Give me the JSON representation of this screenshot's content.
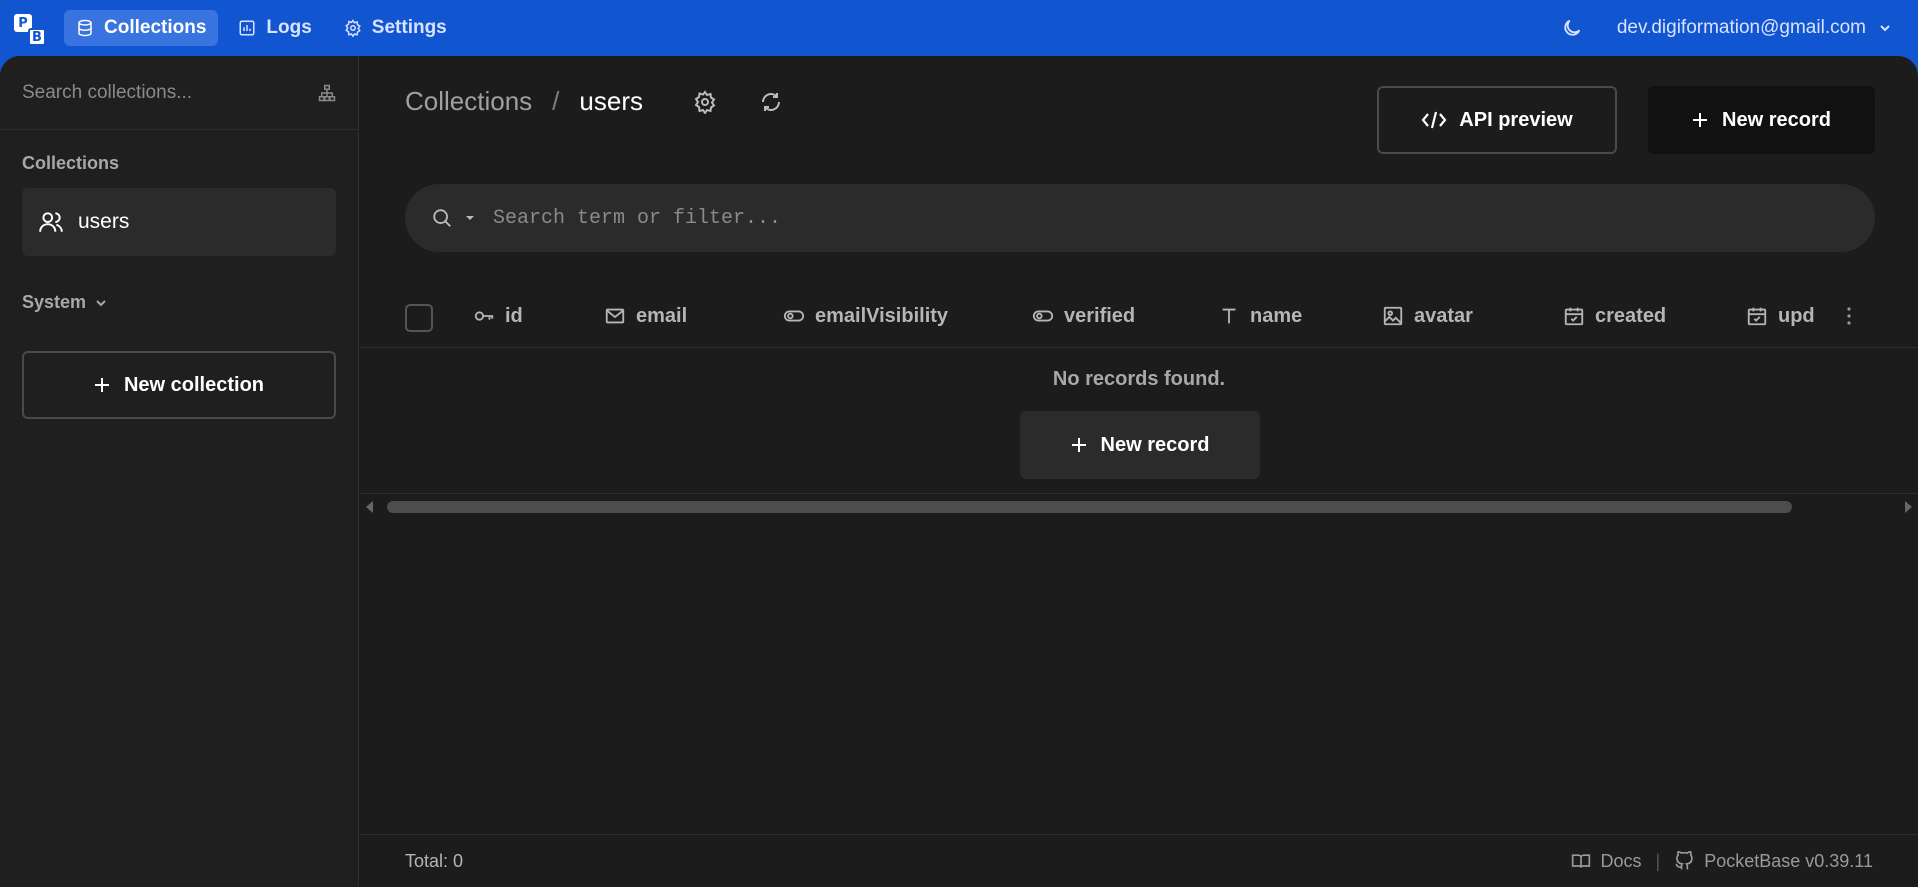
{
  "topbar": {
    "logo_letters": [
      "P",
      "B"
    ],
    "nav": [
      {
        "label": "Collections",
        "icon": "database-icon",
        "active": true
      },
      {
        "label": "Logs",
        "icon": "chart-icon",
        "active": false
      },
      {
        "label": "Settings",
        "icon": "gear-icon",
        "active": false
      }
    ],
    "theme_icon": "moon-icon",
    "user_email": "dev.digiformation@gmail.com"
  },
  "sidebar": {
    "search_placeholder": "Search collections...",
    "section_label": "Collections",
    "collections": [
      {
        "label": "users",
        "icon": "users-icon"
      }
    ],
    "system_label": "System",
    "new_collection_label": "New collection"
  },
  "main": {
    "breadcrumb": {
      "root": "Collections",
      "separator": "/",
      "current": "users"
    },
    "api_preview_label": "API preview",
    "new_record_label": "New record",
    "search_placeholder": "Search term or filter...",
    "columns": [
      {
        "label": "id",
        "icon": "key-icon"
      },
      {
        "label": "email",
        "icon": "mail-icon"
      },
      {
        "label": "emailVisibility",
        "icon": "toggle-icon"
      },
      {
        "label": "verified",
        "icon": "toggle-icon"
      },
      {
        "label": "name",
        "icon": "text-icon"
      },
      {
        "label": "avatar",
        "icon": "image-icon"
      },
      {
        "label": "created",
        "icon": "calendar-icon"
      },
      {
        "label": "upd",
        "icon": "calendar-icon"
      }
    ],
    "empty_message": "No records found.",
    "empty_new_record_label": "New record"
  },
  "footer": {
    "total_label": "Total: 0",
    "docs_label": "Docs",
    "divider": "|",
    "version_label": "PocketBase v0.39.11"
  },
  "colors": {
    "topbar": "#1255d1",
    "background": "#1c1c1c",
    "sidebar": "#1f1f1f"
  }
}
